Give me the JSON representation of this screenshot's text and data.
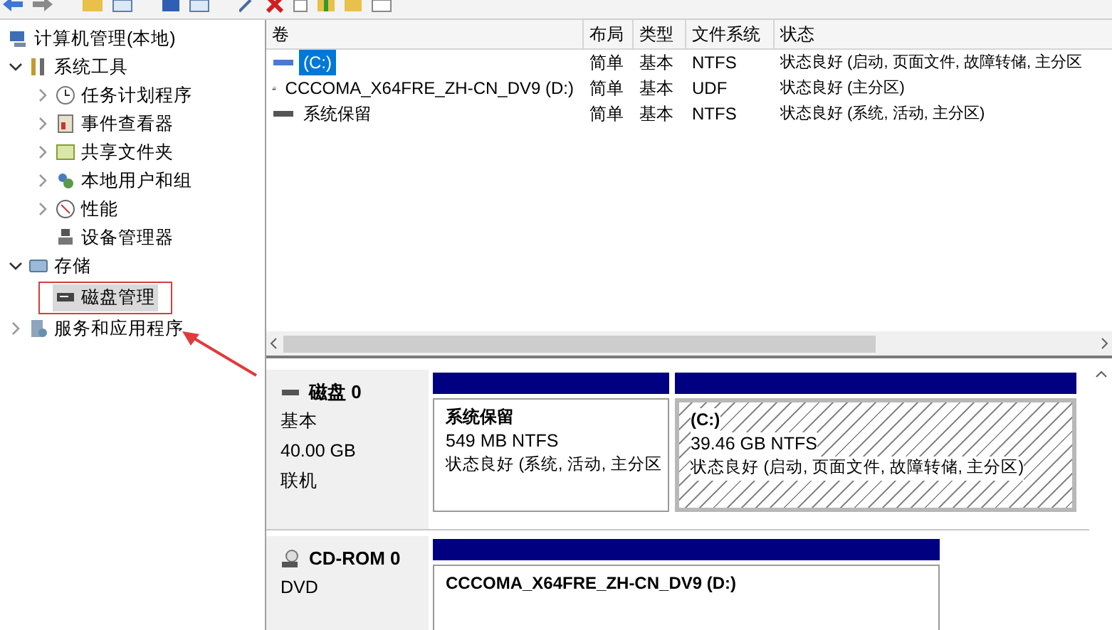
{
  "tree": [
    {
      "label": "计算机管理(本地)",
      "kind": "root",
      "selected": false,
      "children": [
        {
          "label": "系统工具",
          "kind": "node",
          "expanded": true,
          "selected": false,
          "children": [
            {
              "label": "任务计划程序",
              "kind": "node",
              "expanded": false,
              "selected": false
            },
            {
              "label": "事件查看器",
              "kind": "node",
              "expanded": false,
              "selected": false
            },
            {
              "label": "共享文件夹",
              "kind": "node",
              "expanded": false,
              "selected": false
            },
            {
              "label": "本地用户和组",
              "kind": "node",
              "expanded": false,
              "selected": false
            },
            {
              "label": "性能",
              "kind": "node",
              "expanded": false,
              "selected": false
            },
            {
              "label": "设备管理器",
              "kind": "leaf",
              "selected": false
            }
          ]
        },
        {
          "label": "存储",
          "kind": "node",
          "expanded": true,
          "selected": false,
          "children": [
            {
              "label": "磁盘管理",
              "kind": "leaf",
              "selected": true
            }
          ]
        },
        {
          "label": "服务和应用程序",
          "kind": "node",
          "expanded": false,
          "selected": false
        }
      ]
    }
  ],
  "volumes": {
    "columns": [
      "卷",
      "布局",
      "类型",
      "文件系统",
      "状态"
    ],
    "rows": [
      {
        "kind": "hdd",
        "selected": true,
        "cells": [
          "(C:)",
          "简单",
          "基本",
          "NTFS",
          "状态良好 (启动, 页面文件, 故障转储, 主分区"
        ]
      },
      {
        "kind": "cd",
        "selected": false,
        "cells": [
          "CCCOMA_X64FRE_ZH-CN_DV9 (D:)",
          "简单",
          "基本",
          "UDF",
          "状态良好 (主分区)"
        ]
      },
      {
        "kind": "hdd",
        "selected": false,
        "cells": [
          "系统保留",
          "简单",
          "基本",
          "NTFS",
          "状态良好 (系统, 活动, 主分区)"
        ]
      }
    ]
  },
  "disks": [
    {
      "kind": "disk",
      "name": "磁盘 0",
      "lines": [
        "基本",
        "40.00 GB",
        "联机"
      ],
      "partitions": [
        {
          "title": "系统保留",
          "size": "549 MB NTFS",
          "status": "状态良好 (系统, 活动, 主分区",
          "selected": false
        },
        {
          "title": "(C:)",
          "size": "39.46 GB NTFS",
          "status": "状态良好 (启动, 页面文件, 故障转储, 主分区)",
          "selected": true
        }
      ]
    },
    {
      "kind": "cdrom",
      "name": "CD-ROM 0",
      "lines": [
        "DVD"
      ],
      "partitions": [
        {
          "title": "CCCOMA_X64FRE_ZH-CN_DV9  (D:)",
          "selected": false
        }
      ]
    }
  ]
}
